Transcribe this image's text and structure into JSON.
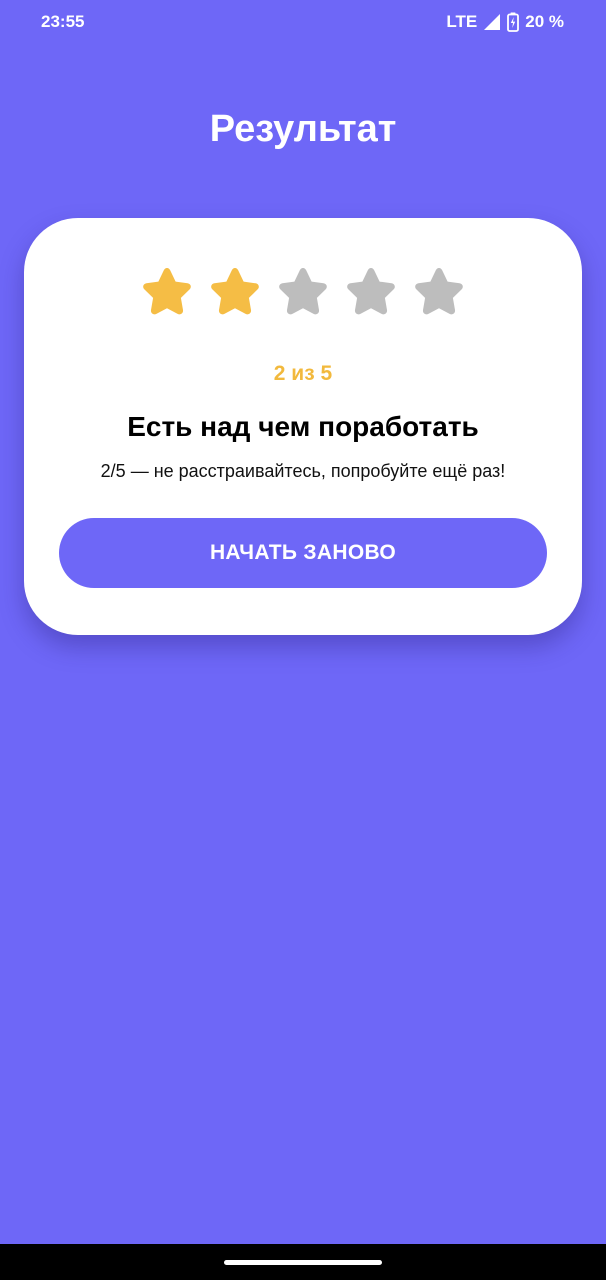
{
  "status_bar": {
    "time": "23:55",
    "network": "LTE",
    "battery": "20 %",
    "battery_level": 0.2
  },
  "title": "Результат",
  "rating": {
    "value": 2,
    "max": 5,
    "filled_color": "#f5bd45",
    "empty_color": "#bdbdbd",
    "label": "2 из 5"
  },
  "result": {
    "headline": "Есть над чем поработать",
    "message": "2/5 — не расстраивайтесь, попробуйте ещё раз!"
  },
  "actions": {
    "restart_label": "НАЧАТЬ ЗАНОВО"
  },
  "colors": {
    "background": "#6e67f7",
    "accent": "#f2b93d",
    "card": "#ffffff"
  }
}
